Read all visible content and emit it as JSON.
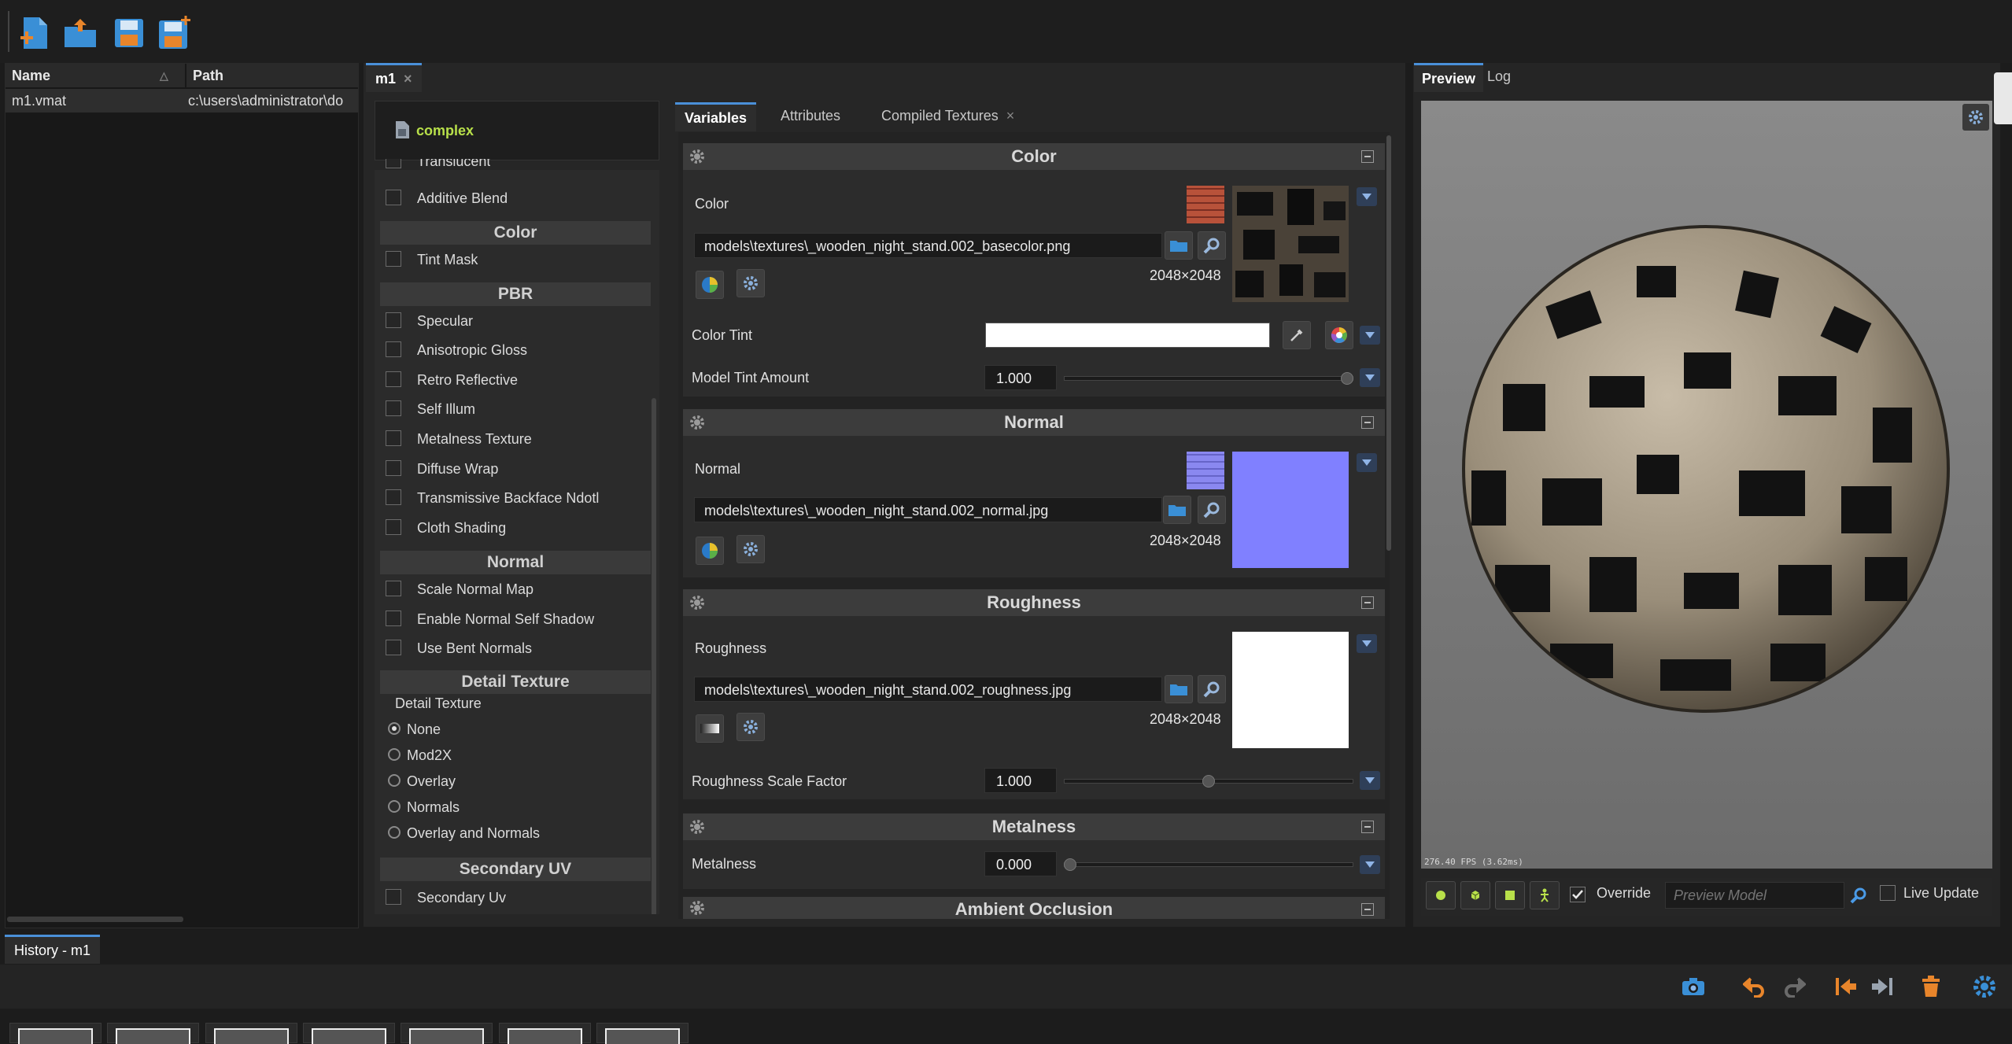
{
  "toolbar": {
    "icons": [
      "new-file-icon",
      "open-file-icon",
      "save-icon",
      "save-as-icon"
    ]
  },
  "assets": {
    "columns": [
      "Name",
      "Path"
    ],
    "rows": [
      {
        "name": "m1.vmat",
        "path": "c:\\users\\administrator\\do"
      }
    ]
  },
  "document_tab": {
    "label": "m1",
    "close": "×"
  },
  "shader": {
    "label": "complex"
  },
  "features": {
    "partial_item": "Translucent",
    "additive_blend": "Additive Blend",
    "sections": {
      "color": "Color",
      "pbr": "PBR",
      "normal": "Normal",
      "detail_texture": "Detail Texture",
      "secondary_uv": "Secondary UV"
    },
    "color_items": [
      "Tint Mask"
    ],
    "pbr_items": [
      "Specular",
      "Anisotropic Gloss",
      "Retro Reflective",
      "Self Illum",
      "Metalness Texture",
      "Diffuse Wrap",
      "Transmissive Backface Ndotl",
      "Cloth Shading"
    ],
    "normal_items": [
      "Scale Normal Map",
      "Enable Normal Self Shadow",
      "Use Bent Normals"
    ],
    "detail_label": "Detail Texture",
    "detail_options": [
      "None",
      "Mod2X",
      "Overlay",
      "Normals",
      "Overlay and Normals"
    ],
    "detail_selected": "None",
    "secondary_uv_items": [
      "Secondary Uv"
    ]
  },
  "variables_tabs": {
    "variables": "Variables",
    "attributes": "Attributes",
    "compiled_textures": "Compiled Textures",
    "close": "×"
  },
  "variables": {
    "color": {
      "title": "Color",
      "label": "Color",
      "path": "models\\textures\\_wooden_night_stand.002_basecolor.png",
      "resolution": "2048×2048",
      "tint_label": "Color Tint",
      "tint_value": "#ffffff",
      "model_tint_label": "Model Tint Amount",
      "model_tint_value": "1.000",
      "model_tint_fraction": 1.0
    },
    "normal": {
      "title": "Normal",
      "label": "Normal",
      "path": "models\\textures\\_wooden_night_stand.002_normal.jpg",
      "resolution": "2048×2048",
      "swatch_color": "#8080ff"
    },
    "roughness": {
      "title": "Roughness",
      "label": "Roughness",
      "path": "models\\textures\\_wooden_night_stand.002_roughness.jpg",
      "resolution": "2048×2048",
      "scale_label": "Roughness Scale Factor",
      "scale_value": "1.000",
      "scale_fraction": 0.5
    },
    "metalness": {
      "title": "Metalness",
      "label": "Metalness",
      "value": "0.000",
      "fraction": 0.0
    },
    "ambient_occlusion": {
      "title": "Ambient Occlusion"
    }
  },
  "preview": {
    "tabs": [
      "Preview",
      "Log"
    ],
    "stats": "276.40 FPS (3.62ms)",
    "override_label": "Override",
    "override_checked": true,
    "model_placeholder": "Preview Model",
    "live_update_label": "Live Update"
  },
  "history": {
    "tab_label": "History - m1",
    "thumb_count": 7
  },
  "colors": {
    "accent": "#4a90d9",
    "shader_label": "#b8e04a",
    "icon_blue": "#3a8fd6",
    "icon_orange": "#e8852b"
  }
}
